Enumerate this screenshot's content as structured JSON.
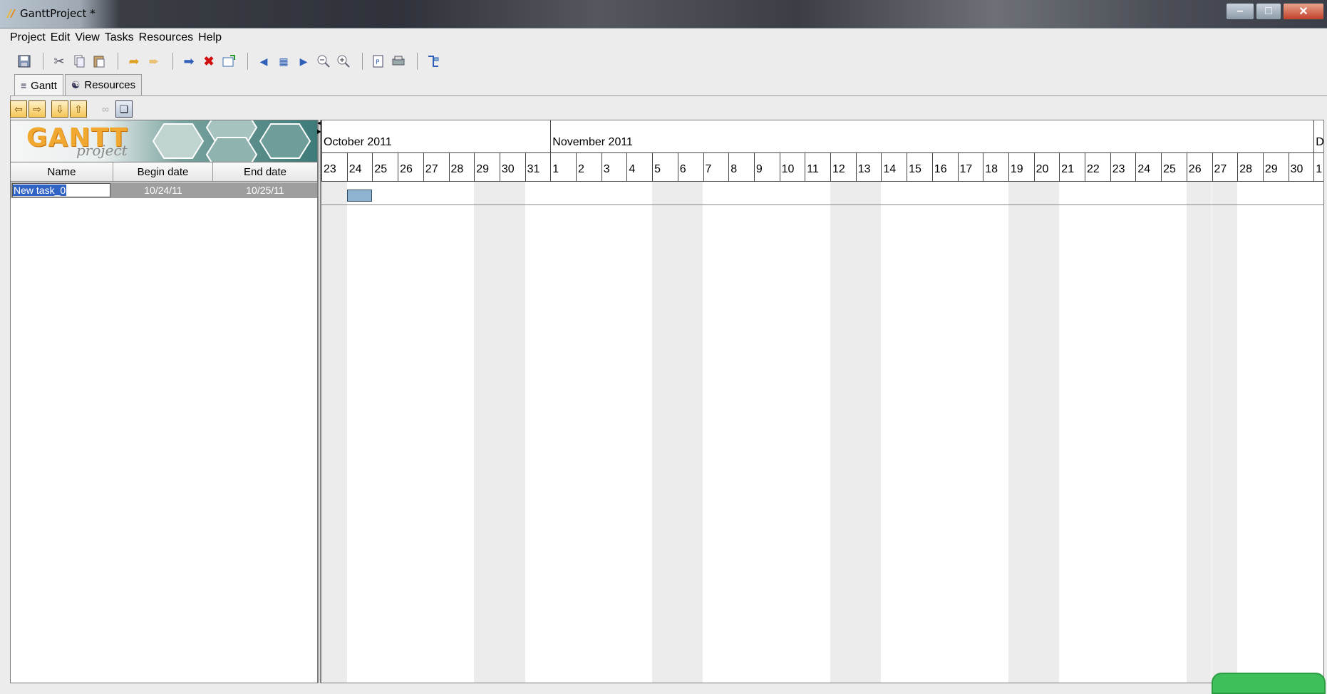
{
  "window": {
    "title": "GanttProject *"
  },
  "menu": [
    "Project",
    "Edit",
    "View",
    "Tasks",
    "Resources",
    "Help"
  ],
  "toolbar_icons": [
    "save-icon",
    "sep",
    "cut-icon",
    "copy-icon",
    "paste-icon",
    "sep",
    "undo-icon",
    "redo-icon",
    "sep",
    "indent-icon",
    "delete-icon",
    "properties-icon",
    "sep",
    "scroll-left-icon",
    "fit-icon",
    "scroll-right-icon",
    "zoom-out-icon",
    "zoom-in-icon",
    "sep",
    "preview-icon",
    "print-icon",
    "sep",
    "critical-path-icon"
  ],
  "tabs": [
    {
      "label": "Gantt",
      "active": true
    },
    {
      "label": "Resources",
      "active": false
    }
  ],
  "logo": {
    "brand": "GANTT",
    "sub": "project"
  },
  "task_table": {
    "columns": [
      "Name",
      "Begin date",
      "End date"
    ],
    "rows": [
      {
        "name": "New task_0",
        "begin": "10/24/11",
        "end": "10/25/11"
      }
    ]
  },
  "timeline": {
    "months": [
      "October 2011",
      "November 2011",
      "De"
    ],
    "days": [
      "23",
      "24",
      "25",
      "26",
      "27",
      "28",
      "29",
      "30",
      "31",
      "1",
      "2",
      "3",
      "4",
      "5",
      "6",
      "7",
      "8",
      "9",
      "10",
      "11",
      "12",
      "13",
      "14",
      "15",
      "16",
      "17",
      "18",
      "19",
      "20",
      "21",
      "22",
      "23",
      "24",
      "25",
      "26",
      "27",
      "28",
      "29",
      "30",
      "1"
    ],
    "weekend_day_indices": [
      0,
      6,
      7,
      13,
      14,
      20,
      21,
      27,
      28,
      34,
      35
    ],
    "task": {
      "start_day_index": 1,
      "duration_days": 1
    }
  },
  "colors": {
    "task_bar": "#8eb4cf",
    "weekend": "#ececec",
    "selection": "#3163c5"
  }
}
